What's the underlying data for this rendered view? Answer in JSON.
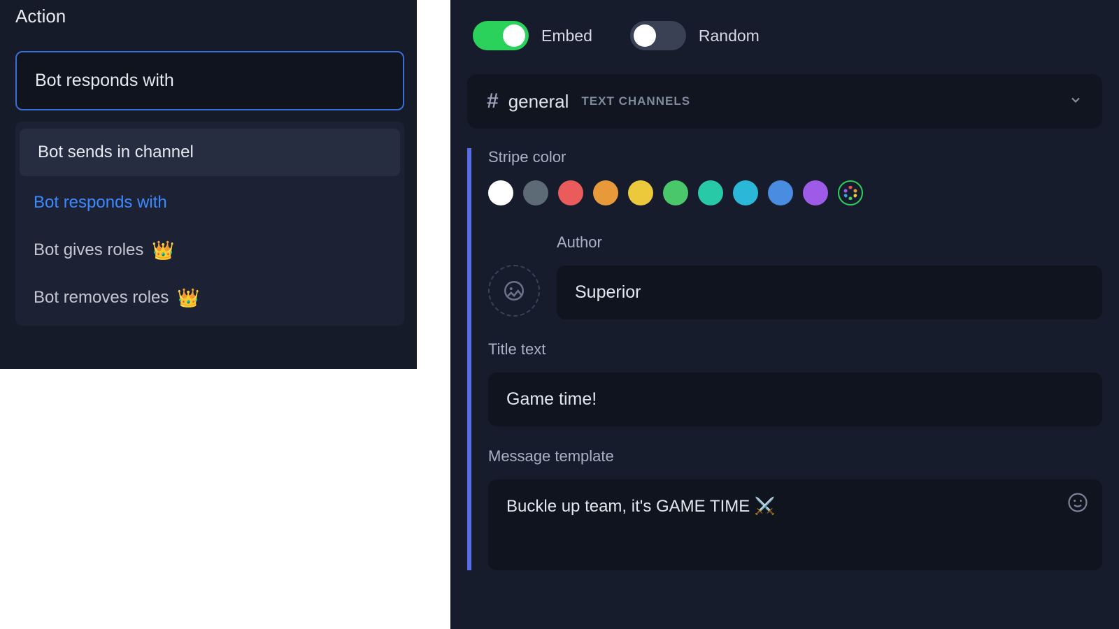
{
  "left": {
    "heading": "Action",
    "selected": "Bot responds with",
    "options": [
      {
        "label": "Bot sends in channel",
        "highlighted": true,
        "active": false,
        "premium": false
      },
      {
        "label": "Bot responds with",
        "highlighted": false,
        "active": true,
        "premium": false
      },
      {
        "label": "Bot gives roles",
        "highlighted": false,
        "active": false,
        "premium": true
      },
      {
        "label": "Bot removes roles",
        "highlighted": false,
        "active": false,
        "premium": true
      }
    ]
  },
  "right": {
    "toggles": {
      "embed": {
        "label": "Embed",
        "on": true
      },
      "random": {
        "label": "Random",
        "on": false
      }
    },
    "channel": {
      "name": "general",
      "category": "TEXT CHANNELS"
    },
    "stripe": {
      "label": "Stripe color",
      "colors": [
        "#ffffff",
        "#5d6b76",
        "#ea5b5b",
        "#e89a3a",
        "#ecc93a",
        "#49c76a",
        "#28c9a7",
        "#2bb7d8",
        "#4a8ce0",
        "#9d5be8"
      ]
    },
    "author": {
      "label": "Author",
      "value": "Superior"
    },
    "title": {
      "label": "Title text",
      "value": "Game time!"
    },
    "message": {
      "label": "Message template",
      "value": "Buckle up team, it's GAME TIME ⚔️"
    }
  }
}
